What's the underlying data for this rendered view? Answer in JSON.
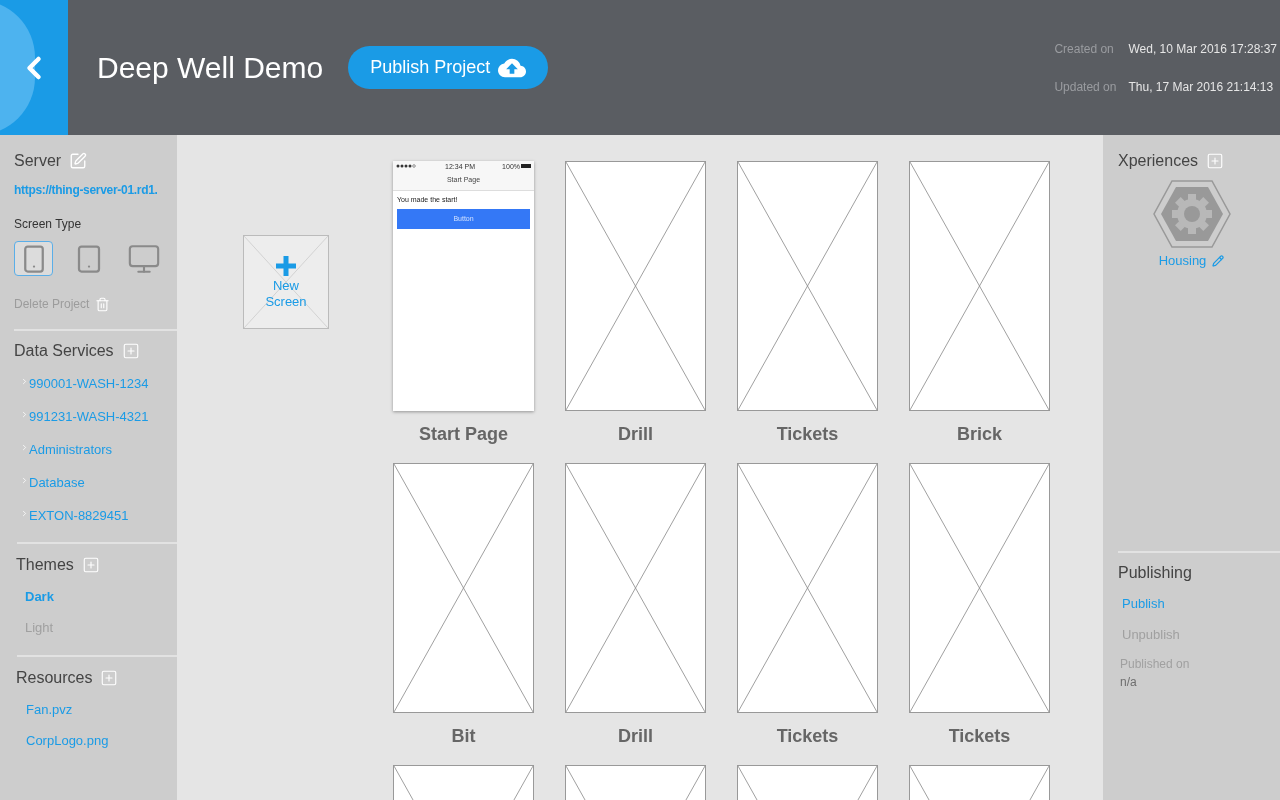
{
  "header": {
    "title": "Deep Well Demo",
    "publish_button": "Publish Project",
    "created_label": "Created on",
    "created_value": "Wed, 10 Mar 2016 17:28:37",
    "updated_label": "Updated on",
    "updated_value": "Thu, 17 Mar 2016 21:14:13"
  },
  "left": {
    "server": {
      "heading": "Server",
      "url": "https://thing-server-01.rd1."
    },
    "screen_type": {
      "label": "Screen Type",
      "options": [
        {
          "kind": "phone",
          "selected": true
        },
        {
          "kind": "tablet",
          "selected": false
        },
        {
          "kind": "desktop",
          "selected": false
        }
      ]
    },
    "delete_project": "Delete Project",
    "data_services": {
      "heading": "Data Services",
      "items": [
        "990001-WASH-1234",
        "991231-WASH-4321",
        "Administrators",
        "Database",
        "EXTON-8829451"
      ]
    },
    "themes": {
      "heading": "Themes",
      "items": [
        {
          "label": "Dark",
          "selected": true
        },
        {
          "label": "Light",
          "selected": false
        }
      ]
    },
    "resources": {
      "heading": "Resources",
      "items": [
        "Fan.pvz",
        "CorpLogo.png"
      ]
    }
  },
  "canvas": {
    "new_screen": "New Screen",
    "screens": [
      {
        "kind": "preview",
        "name": "Start Page",
        "preview": {
          "time": "12:34 PM",
          "battery": "100%",
          "title": "Start Page",
          "text": "You made the start!",
          "button": "Button"
        }
      },
      {
        "kind": "blank",
        "name": "Drill"
      },
      {
        "kind": "blank",
        "name": "Tickets"
      },
      {
        "kind": "blank",
        "name": "Brick"
      },
      {
        "kind": "blank",
        "name": "Bit"
      },
      {
        "kind": "blank",
        "name": "Drill"
      },
      {
        "kind": "blank",
        "name": "Tickets"
      },
      {
        "kind": "blank",
        "name": "Tickets"
      },
      {
        "kind": "blank"
      },
      {
        "kind": "blank"
      },
      {
        "kind": "blank"
      },
      {
        "kind": "blank"
      }
    ]
  },
  "right": {
    "xperiences": {
      "heading": "Xperiences",
      "items": [
        {
          "label": "Housing"
        }
      ]
    },
    "publishing": {
      "heading": "Publishing",
      "actions": [
        {
          "label": "Publish",
          "disabled": false
        },
        {
          "label": "Unpublish",
          "disabled": true
        }
      ],
      "published_label": "Published on",
      "published_value": "n/a"
    }
  }
}
